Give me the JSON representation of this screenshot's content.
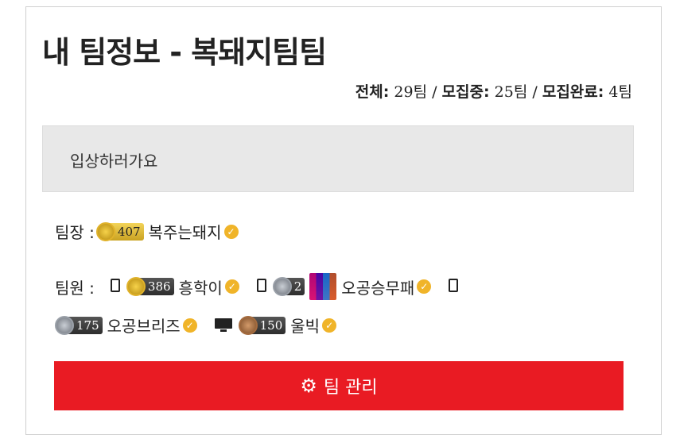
{
  "page": {
    "title": "내 팀정보 - 복돼지팀팀"
  },
  "stats": {
    "total_label": "전체:",
    "total_value": "29팀",
    "sep1": "/",
    "recruiting_label": "모집중:",
    "recruiting_value": "25팀",
    "sep2": "/",
    "complete_label": "모집완료:",
    "complete_value": "4팀"
  },
  "team": {
    "slogan": "입상하러가요"
  },
  "leader": {
    "label": "팀장 :",
    "badge_level": "407",
    "name": "복주는돼지"
  },
  "members": {
    "label": "팀원 :",
    "list": [
      {
        "device": "phone",
        "badge_level": "386",
        "tier": "gold",
        "name": "흥학이"
      },
      {
        "device": "phone",
        "badge_level": "2",
        "tier": "silver",
        "name": "오공승무패"
      },
      {
        "device": "phone",
        "badge_level": "175",
        "tier": "silver",
        "name": "오공브리즈"
      },
      {
        "device": "monitor",
        "badge_level": "150",
        "tier": "bronze",
        "name": "울빅"
      }
    ]
  },
  "actions": {
    "manage_label": "팀 관리"
  },
  "colors": {
    "accent_red": "#e91b23",
    "verified": "#f0b429",
    "team_box_bg": "#e8e8e8"
  },
  "icons": {
    "verified": "check-badge-icon",
    "gear": "gear-icon",
    "phone": "phone-icon",
    "monitor": "monitor-icon"
  }
}
